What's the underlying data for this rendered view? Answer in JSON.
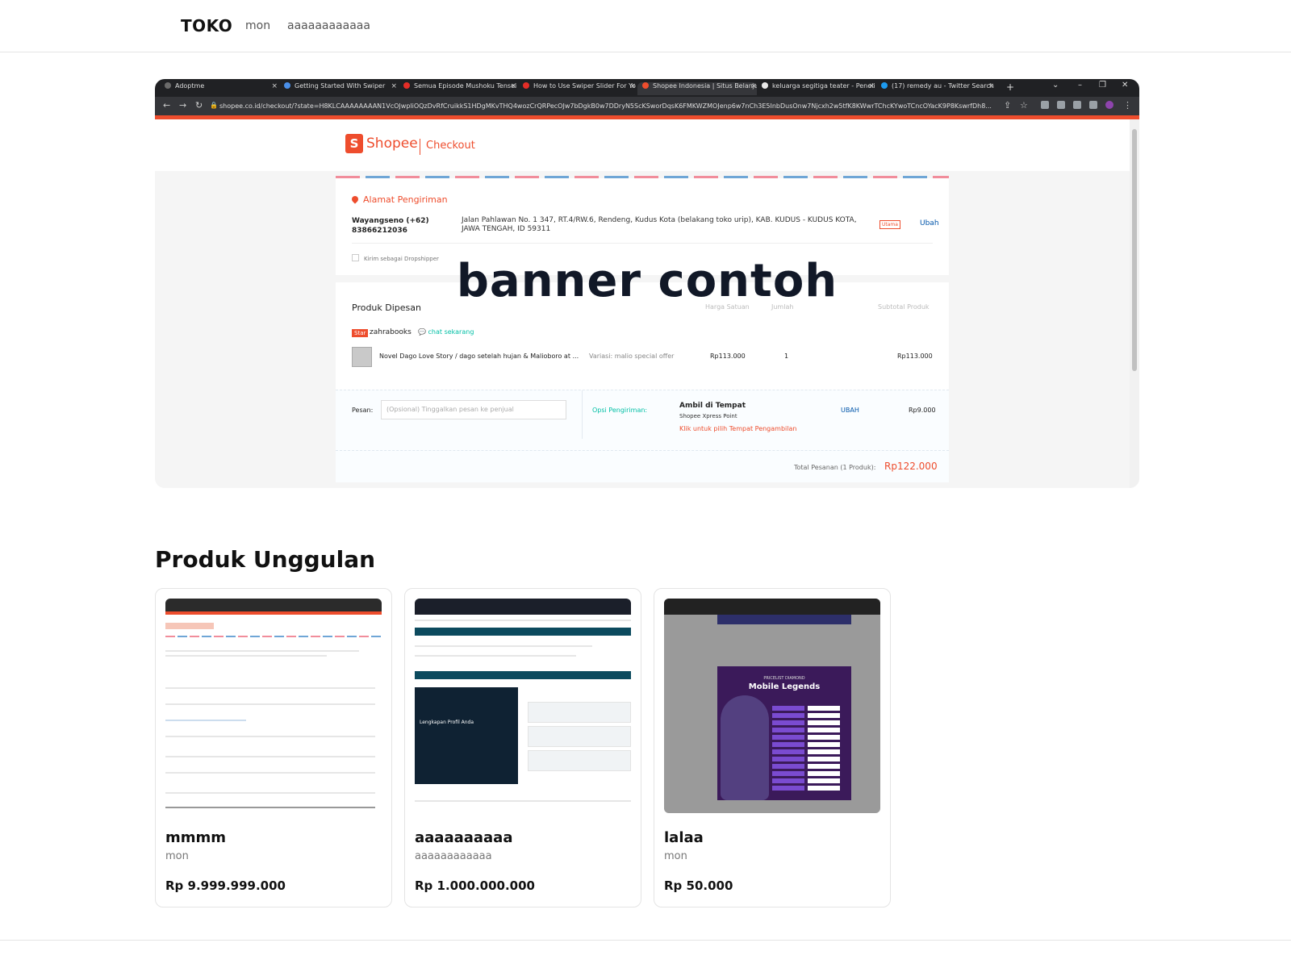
{
  "nav": {
    "brand": "TOKO",
    "links": [
      "mon",
      "aaaaaaaaaaaa"
    ]
  },
  "banner": {
    "overlay_text": "banner contoh",
    "browser": {
      "tabs": [
        "Adoptme",
        "Getting Started With Swiper",
        "Semua Episode Mushoku Tensei",
        "How to Use Swiper Slider For Yo",
        "Shopee Indonesia | Situs Belanja",
        "keluarga segitiga teater - Peneliti",
        "(17) remedy au - Twitter Search"
      ],
      "url": "shopee.co.id/checkout/?state=H8KLCAAAAAAAAN1VcOJwpliOQzDvRfCruikkS1HDgMKvTHQ4wozCrQRPecOJw7bDgkB0w7DDryN5ScKSworDqsK6FMKWZMOJenp6w7nCh3E5InbDusOnw7Njcxh2w5tfK8KWwrTChcKYwoTCncOYacK9P8KswrfDh8..."
    },
    "shopee": {
      "logo": "Shopee",
      "checkout": "Checkout",
      "address_title": "Alamat Pengiriman",
      "recipient": "Wayangseno (+62) 83866212036",
      "address": "Jalan Pahlawan No. 1 347, RT.4/RW.6, Rendeng, Kudus Kota (belakang toko urip), KAB. KUDUS - KUDUS KOTA, JAWA TENGAH, ID 59311",
      "badge": "Utama",
      "change": "Ubah",
      "dropship": "Kirim sebagai Dropshipper",
      "products_title": "Produk Dipesan",
      "col_unit_price": "Harga Satuan",
      "col_qty": "Jumlah",
      "col_subtotal": "Subtotal Produk",
      "star_badge": "Star",
      "shop_name": "zahrabooks",
      "chat": "chat sekarang",
      "item_name": "Novel Dago Love Story / dago setelah hujan & Malioboro at ...",
      "item_variant": "Variasi: malio special offer",
      "item_price": "Rp113.000",
      "item_qty": "1",
      "item_subtotal": "Rp113.000",
      "message_label": "Pesan:",
      "message_placeholder": "(Opsional) Tinggalkan pesan ke penjual",
      "shipping_label": "Opsi Pengiriman:",
      "shipping_method": "Ambil di Tempat",
      "shipping_point": "Shopee Xpress Point",
      "shipping_link": "Klik untuk pilih Tempat Pengambilan",
      "shipping_change": "UBAH",
      "shipping_cost": "Rp9.000",
      "total_label": "Total Pesanan (1 Produk):",
      "total_value": "Rp122.000"
    }
  },
  "section": {
    "title": "Produk Unggulan"
  },
  "products": [
    {
      "name": "mmmm",
      "category": "mon",
      "price": "Rp 9.999.999.000"
    },
    {
      "name": "aaaaaaaaaa",
      "category": "aaaaaaaaaaaa",
      "price": "Rp 1.000.000.000"
    },
    {
      "name": "lalaa",
      "category": "mon",
      "price": "Rp 50.000"
    }
  ],
  "thumb2": {
    "heading": "Lengkapan Profil Anda"
  },
  "thumb3": {
    "small": "PRICELIST DIAMOND",
    "title": "Mobile Legends"
  },
  "colors": {
    "shopee_orange": "#ee4d2d",
    "teal": "#00bfa5",
    "text_dark": "#111827"
  }
}
